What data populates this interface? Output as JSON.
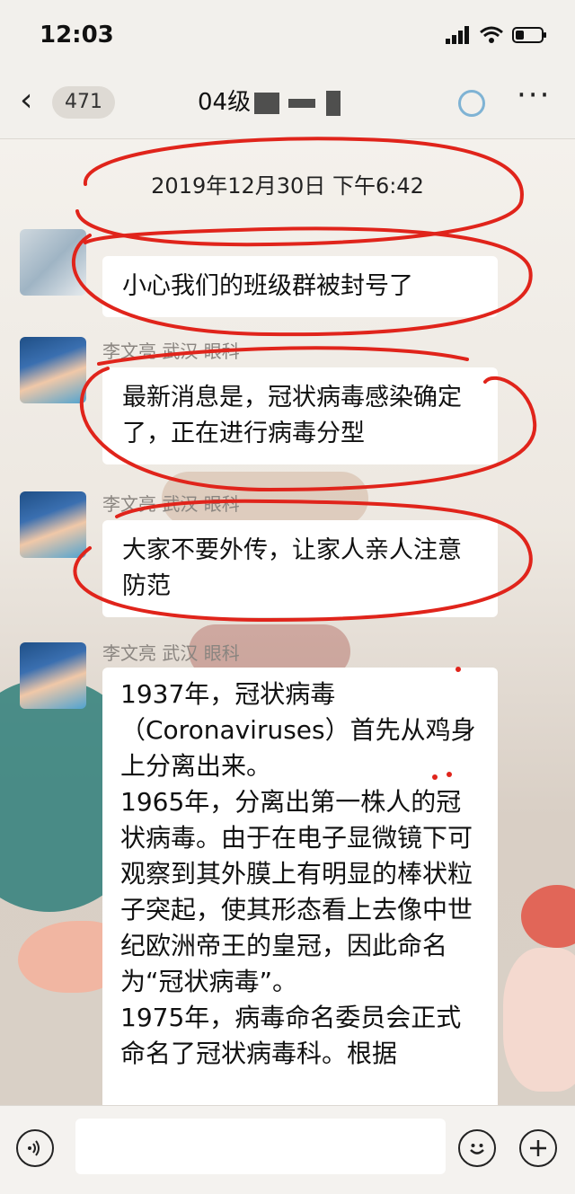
{
  "status_bar": {
    "time": "12:03"
  },
  "nav": {
    "back_count": "471",
    "title": "04级"
  },
  "chat": {
    "timestamp": "2019年12月30日 下午6:42",
    "messages": [
      {
        "sender": "",
        "text": "小心我们的班级群被封号了"
      },
      {
        "sender": "李文亮 武汉 眼科",
        "text": "最新消息是，冠状病毒感染确定了，正在进行病毒分型"
      },
      {
        "sender": "李文亮 武汉 眼科",
        "text": "大家不要外传，让家人亲人注意防范"
      },
      {
        "sender": "李文亮 武汉 眼科",
        "text": "1937年，冠状病毒（Coronaviruses）首先从鸡身上分离出来。\n1965年，分离出第一株人的冠状病毒。由于在电子显微镜下可观察到其外膜上有明显的棒状粒子突起，使其形态看上去像中世纪欧洲帝王的皇冠，因此命名为“冠状病毒”。\n1975年，病毒命名委员会正式命名了冠状病毒科。根据"
      }
    ]
  },
  "input_bar": {
    "voice_icon": "voice-icon",
    "emoji_icon": "emoji-icon",
    "plus_icon": "plus-icon"
  },
  "annotation_color": "#e0241b"
}
